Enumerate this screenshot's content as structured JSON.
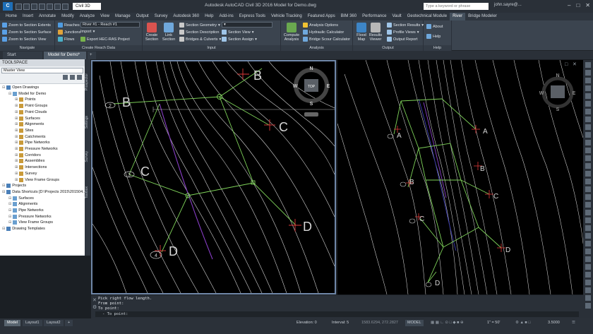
{
  "titlebar": {
    "app_logo": "C",
    "workspace": "Civil 3D",
    "doc_title": "Autodesk AutoCAD Civil 3D 2016    Model for Demo.dwg",
    "search_placeholder": "Type a keyword or phrase",
    "user": "john.sayre@..."
  },
  "menu_tabs": [
    "Home",
    "Insert",
    "Annotate",
    "Modify",
    "Analyze",
    "View",
    "Manage",
    "Output",
    "Survey",
    "Autodesk 360",
    "Help",
    "Add-ins",
    "Express Tools",
    "Vehicle Tracking",
    "Featured Apps",
    "BIM 360",
    "Performance",
    "Vault",
    "Geotechnical Module",
    "River",
    "Bridge Modeler"
  ],
  "active_menu_tab": "River",
  "ribbon": {
    "navigate": {
      "title": "Navigate",
      "items": [
        "Zoom to Section Extents",
        "Zoom to Section Surface",
        "Zoom to Section View"
      ]
    },
    "reach": {
      "title": "Create Reach Data",
      "reaches": "Reaches",
      "junctions": "Junctions",
      "flows": "Flows",
      "reach_combo": "River #1 - Reach #1",
      "import": "Import",
      "export": "Export HEC-RAS Project"
    },
    "input": {
      "title": "Input",
      "create_section": "Create Section",
      "link_section": "Link Section",
      "section_geometry": "Section Geometry",
      "section_description": "Section Description",
      "bridges_culverts": "Bridges & Culverts",
      "section_view": "Section View",
      "section_assign": "Section Assign"
    },
    "analysis": {
      "title": "Analysis",
      "compute": "Compute Analysis",
      "options": "Analysis Options",
      "hydraulic": "Hydraulic Calculator",
      "scour": "Bridge Scour Calculator"
    },
    "output": {
      "title": "Output",
      "flood_map": "Flood Map",
      "results_viewer": "Results Viewer",
      "section_results": "Section Results",
      "profile_views": "Profile Views",
      "output_report": "Output Report"
    },
    "help": {
      "title": "Help",
      "about": "About",
      "help": "Help"
    }
  },
  "doc_tabs": [
    "Start",
    "Model for Demo*"
  ],
  "toolspace": {
    "title": "TOOLSPACE",
    "view": "Master View",
    "side_tabs": [
      "Prospector",
      "Settings",
      "Survey",
      "Toolbox"
    ],
    "tree": [
      {
        "label": "Open Drawings",
        "level": 0
      },
      {
        "label": "Model for Demo",
        "level": 1
      },
      {
        "label": "Points",
        "level": 2
      },
      {
        "label": "Point Groups",
        "level": 2
      },
      {
        "label": "Point Clouds",
        "level": 2
      },
      {
        "label": "Surfaces",
        "level": 2
      },
      {
        "label": "Alignments",
        "level": 2
      },
      {
        "label": "Sites",
        "level": 2
      },
      {
        "label": "Catchments",
        "level": 2
      },
      {
        "label": "Pipe Networks",
        "level": 2
      },
      {
        "label": "Pressure Networks",
        "level": 2
      },
      {
        "label": "Corridors",
        "level": 2
      },
      {
        "label": "Assemblies",
        "level": 2
      },
      {
        "label": "Intersections",
        "level": 2
      },
      {
        "label": "Survey",
        "level": 2
      },
      {
        "label": "View Frame Groups",
        "level": 2
      },
      {
        "label": "Projects",
        "level": 0
      },
      {
        "label": "Data Shortcuts [D:\\Projects 2015\\201504...",
        "level": 0
      },
      {
        "label": "Surfaces",
        "level": 1
      },
      {
        "label": "Alignments",
        "level": 1
      },
      {
        "label": "Pipe Networks",
        "level": 1
      },
      {
        "label": "Pressure Networks",
        "level": 1
      },
      {
        "label": "View Frame Groups",
        "level": 1
      },
      {
        "label": "Drawing Templates",
        "level": 0
      }
    ]
  },
  "viewport1": {
    "labels": [
      "B",
      "B",
      "C",
      "C",
      "D",
      "D"
    ],
    "markers": [
      "2",
      "3",
      "4"
    ],
    "viewcube": {
      "top": "TOP",
      "n": "N",
      "s": "S",
      "e": "E",
      "w": "W"
    }
  },
  "viewport2": {
    "labels": [
      "A",
      "A",
      "B",
      "B",
      "C",
      "C",
      "D",
      "D"
    ],
    "viewcube": {
      "n": "N",
      "s": "S",
      "e": "E",
      "w": "W"
    }
  },
  "command": {
    "lines": [
      "Pick right flow length.",
      "From point:",
      "To point:"
    ],
    "prompt": "- To point:"
  },
  "layout_tabs": [
    "Model",
    "Layout1",
    "Layout2"
  ],
  "status": {
    "elevation": "Elevation: 0",
    "interval": "Interval: 5",
    "coords": "1583.6294, 272.2827",
    "model": "MODEL",
    "scale": "1\" = 50'",
    "zoom": "3.5000"
  },
  "colors": {
    "accent": "#1e6fb8",
    "contour": "#d6d6d6",
    "crosssection": "#7fd35a",
    "stationmarker": "#e03a3a",
    "flowline": "#8a3fc9"
  }
}
